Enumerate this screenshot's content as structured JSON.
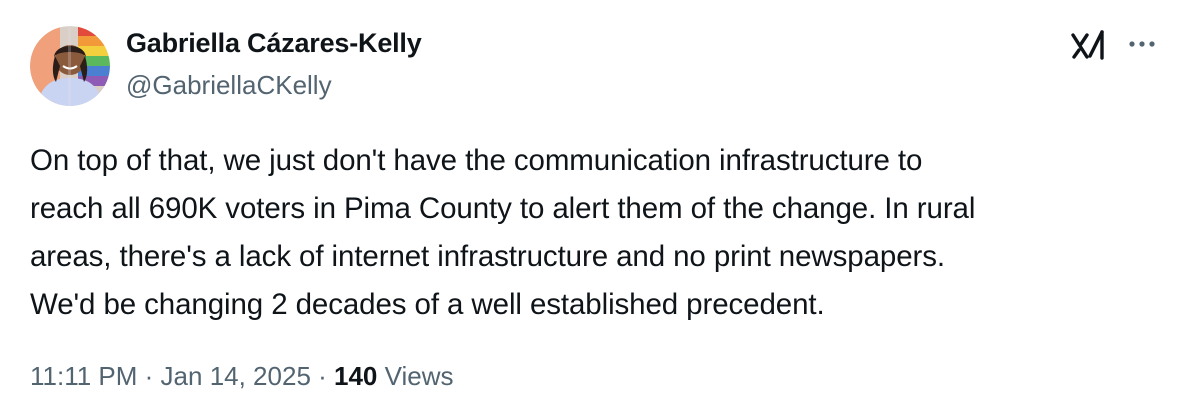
{
  "author": {
    "display_name": "Gabriella Cázares-Kelly",
    "handle": "@GabriellaCKelly"
  },
  "icons": {
    "grok": "grok-icon",
    "more": "more-options-icon"
  },
  "tweet": {
    "lines": [
      "On top of that, we just don't have the communication infrastructure to",
      "reach all 690K voters in Pima County to alert them of the change. In rural",
      "areas, there's a lack of internet infrastructure and no print newspapers.",
      "We'd be changing 2 decades of a well established precedent."
    ],
    "time": "11:11 PM",
    "separator": " · ",
    "date": "Jan 14, 2025",
    "views_count": "140",
    "views_label": " Views"
  },
  "colors": {
    "text": "#0f1419",
    "secondary": "#536471",
    "background": "#ffffff"
  }
}
